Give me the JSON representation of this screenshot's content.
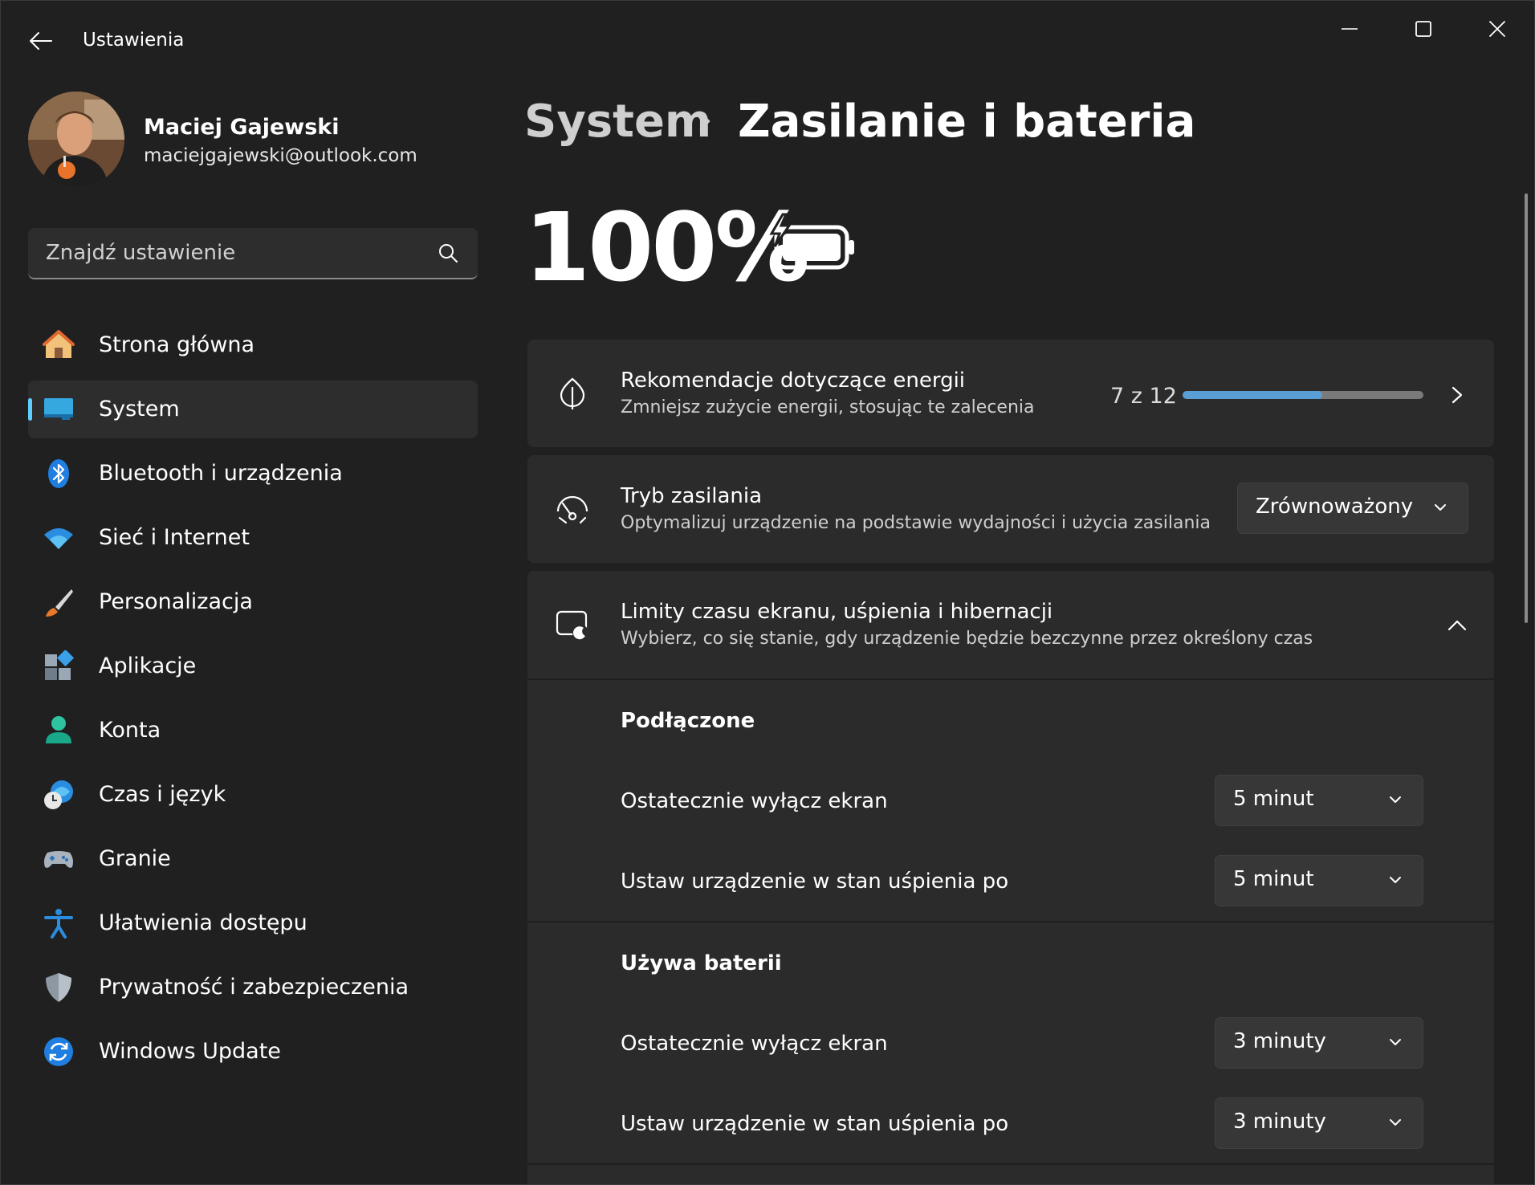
{
  "window": {
    "title": "Ustawienia"
  },
  "profile": {
    "name": "Maciej Gajewski",
    "email": "maciejgajewski@outlook.com"
  },
  "search": {
    "placeholder": "Znajdź ustawienie"
  },
  "sidebar": {
    "items": [
      {
        "label": "Strona główna",
        "icon": "home-icon"
      },
      {
        "label": "System",
        "icon": "system-display-icon",
        "active": true
      },
      {
        "label": "Bluetooth i urządzenia",
        "icon": "bluetooth-icon"
      },
      {
        "label": "Sieć i Internet",
        "icon": "wifi-icon"
      },
      {
        "label": "Personalizacja",
        "icon": "brush-icon"
      },
      {
        "label": "Aplikacje",
        "icon": "apps-icon"
      },
      {
        "label": "Konta",
        "icon": "account-icon"
      },
      {
        "label": "Czas i język",
        "icon": "time-language-icon"
      },
      {
        "label": "Granie",
        "icon": "gamepad-icon"
      },
      {
        "label": "Ułatwienia dostępu",
        "icon": "accessibility-icon"
      },
      {
        "label": "Prywatność i zabezpieczenia",
        "icon": "shield-icon"
      },
      {
        "label": "Windows Update",
        "icon": "windows-update-icon"
      }
    ]
  },
  "breadcrumb": {
    "parent": "System",
    "current": "Zasilanie i bateria"
  },
  "battery": {
    "percent": "100%",
    "charging": true
  },
  "energy_recommendations": {
    "title": "Rekomendacje dotyczące energii",
    "subtitle": "Zmniejsz zużycie energii, stosując te zalecenia",
    "progress_text": "7 z 12",
    "progress_fraction": 0.58
  },
  "power_mode": {
    "title": "Tryb zasilania",
    "subtitle": "Optymalizuj urządzenie na podstawie wydajności i użycia zasilania",
    "selected": "Zrównoważony"
  },
  "screen_sleep": {
    "title": "Limity czasu ekranu, uśpienia i hibernacji",
    "subtitle": "Wybierz, co się stanie, gdy urządzenie będzie bezczynne przez określony czas",
    "plugged_in": {
      "heading": "Podłączone",
      "screen_off_label": "Ostatecznie wyłącz ekran",
      "screen_off_value": "5 minut",
      "sleep_label": "Ustaw urządzenie w stan uśpienia po",
      "sleep_value": "5 minut"
    },
    "on_battery": {
      "heading": "Używa baterii",
      "screen_off_label": "Ostatecznie wyłącz ekran",
      "screen_off_value": "3 minuty",
      "sleep_label": "Ustaw urządzenie w stan uśpienia po",
      "sleep_value": "3 minuty"
    }
  },
  "colors": {
    "accent": "#60cdff",
    "background": "#202020",
    "card": "#2b2b2b",
    "progress_fill": "#5a9ed6"
  }
}
